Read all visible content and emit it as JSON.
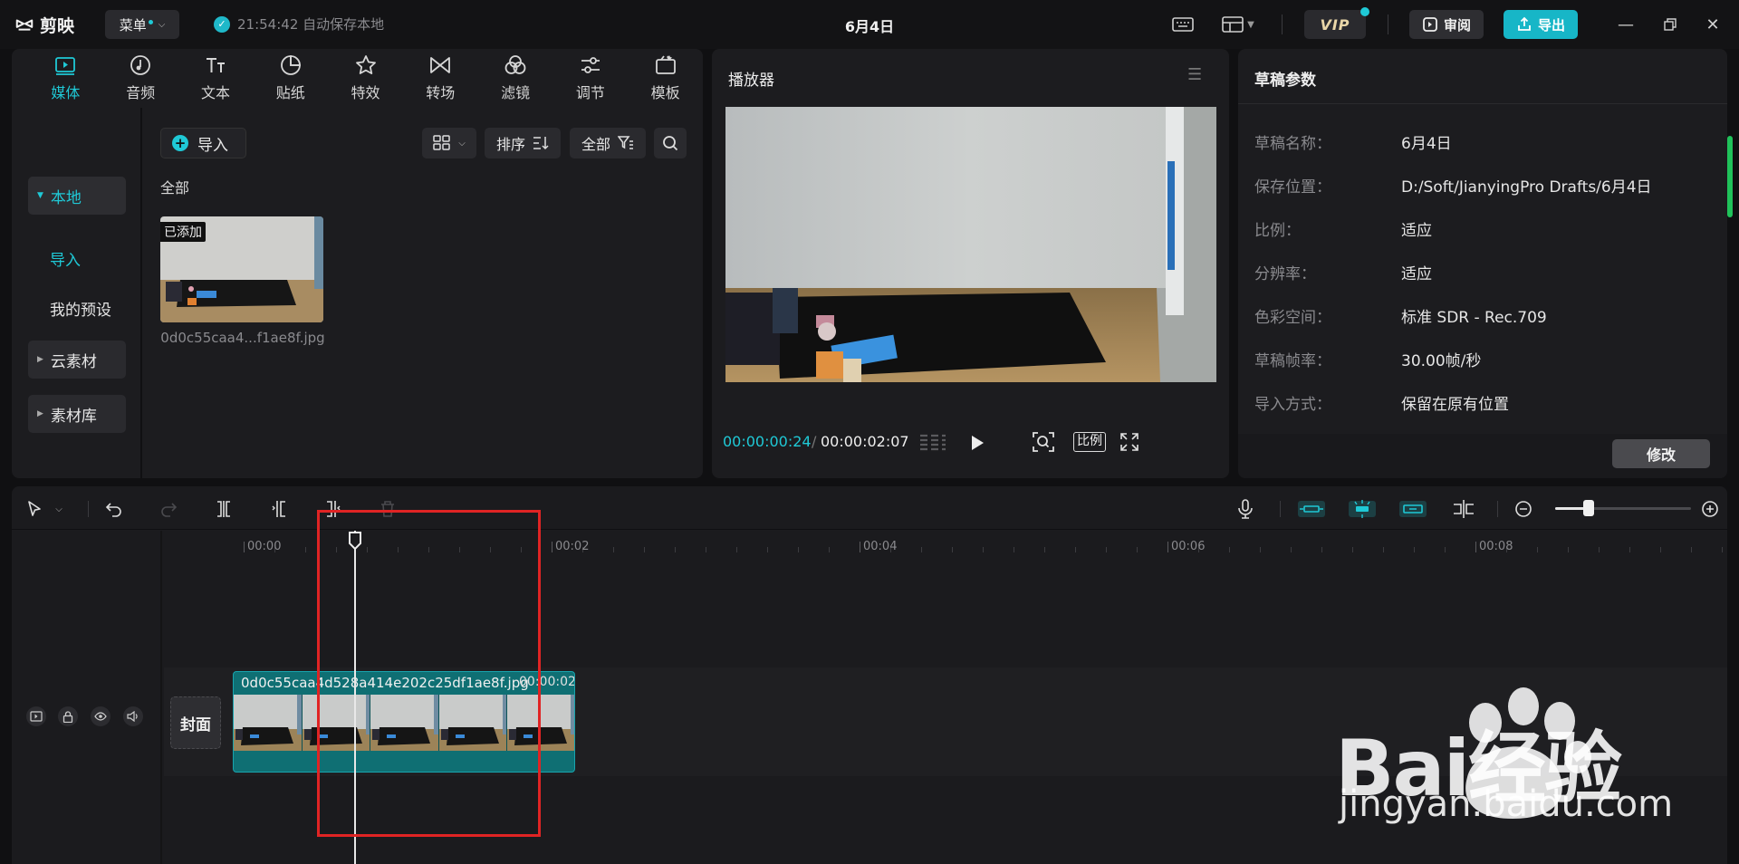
{
  "app": {
    "name": "剪映",
    "menu_label": "菜单",
    "autosave_text": "21:54:42 自动保存本地",
    "project_title": "6月4日",
    "vip_label": "VIP",
    "review_label": "审阅",
    "export_label": "导出"
  },
  "media_tools": [
    {
      "label": "媒体",
      "icon": "media-icon"
    },
    {
      "label": "音频",
      "icon": "audio-icon"
    },
    {
      "label": "文本",
      "icon": "text-icon"
    },
    {
      "label": "贴纸",
      "icon": "sticker-icon"
    },
    {
      "label": "特效",
      "icon": "effects-icon"
    },
    {
      "label": "转场",
      "icon": "transition-icon"
    },
    {
      "label": "滤镜",
      "icon": "filter-icon"
    },
    {
      "label": "调节",
      "icon": "adjust-icon"
    },
    {
      "label": "模板",
      "icon": "template-icon"
    }
  ],
  "side_nav": {
    "local": "本地",
    "import": "导入",
    "my_presets": "我的预设",
    "cloud": "云素材",
    "library": "素材库"
  },
  "media": {
    "import_label": "导入",
    "sort_label": "排序",
    "filter_label": "全部",
    "section_label": "全部",
    "item": {
      "badge": "已添加",
      "name": "0d0c55caa4...f1ae8f.jpg"
    }
  },
  "player": {
    "title": "播放器",
    "current_time": "00:00:00:24",
    "separator": "/",
    "total_time": "00:00:02:07",
    "ratio_label": "比例"
  },
  "draft": {
    "title": "草稿参数",
    "rows": [
      {
        "key": "草稿名称：",
        "value": "6月4日"
      },
      {
        "key": "保存位置：",
        "value": "D:/Soft/JianyingPro Drafts/6月4日"
      },
      {
        "key": "比例：",
        "value": "适应"
      },
      {
        "key": "分辨率：",
        "value": "适应"
      },
      {
        "key": "色彩空间：",
        "value": "标准 SDR - Rec.709"
      },
      {
        "key": "草稿帧率：",
        "value": "30.00帧/秒"
      },
      {
        "key": "导入方式：",
        "value": "保留在原有位置"
      }
    ],
    "modify_label": "修改"
  },
  "timeline": {
    "ruler_labels": [
      "00:00",
      "00:02",
      "00:04",
      "00:06",
      "00:08"
    ],
    "cover_label": "封面",
    "clip_name": "0d0c55caa4d528a414e202c25df1ae8f.jpg",
    "clip_duration": "00:00:02:",
    "zoom_level": 0.25
  },
  "watermark": {
    "brand": "Bai经验",
    "url": "jingyan.baidu.com"
  },
  "colors": {
    "accent": "#1fc9d6",
    "highlight_box": "#e02424",
    "clip": "#0f6f73"
  }
}
